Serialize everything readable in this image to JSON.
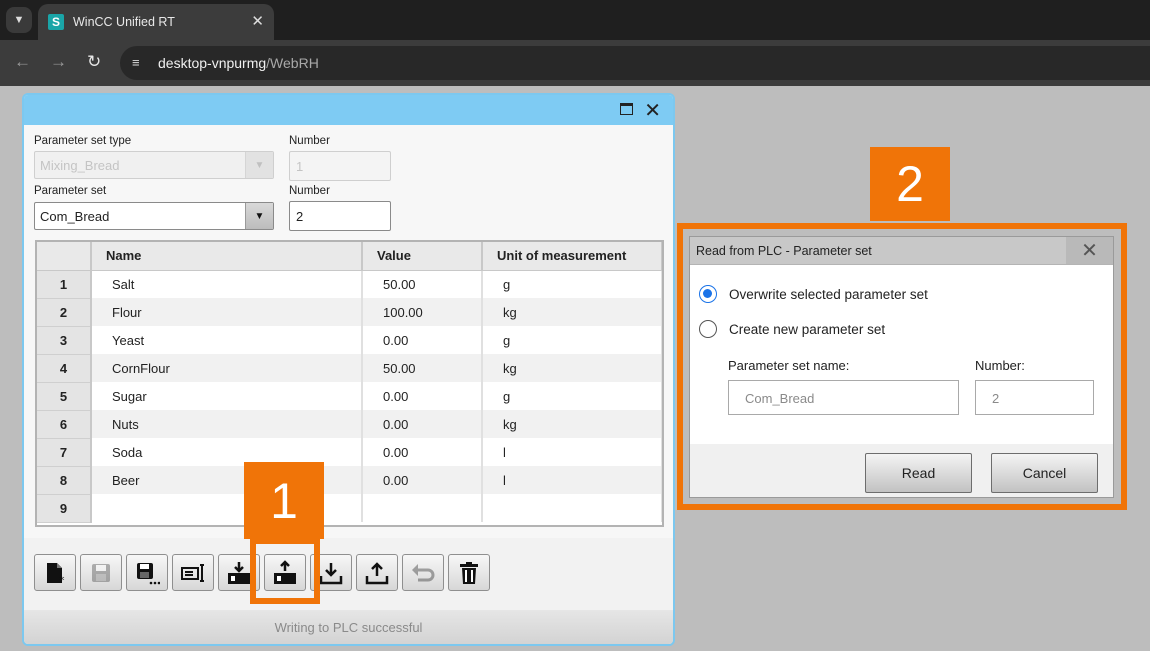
{
  "browser": {
    "tab_title": "WinCC Unified RT",
    "tab_icon_letter": "S",
    "url_host": "desktop-vnpurmg",
    "url_path": "/WebRH"
  },
  "recipe": {
    "set_type_label": "Parameter set type",
    "set_type_value": "Mixing_Bread",
    "number_label_1": "Number",
    "number_value_1": "1",
    "set_label": "Parameter set",
    "set_value": "Com_Bread",
    "number_label_2": "Number",
    "number_value_2": "2",
    "columns": [
      "Name",
      "Value",
      "Unit of measurement"
    ],
    "rows": [
      {
        "n": "1",
        "name": "Salt",
        "value": "50.00",
        "unit": "g"
      },
      {
        "n": "2",
        "name": "Flour",
        "value": "100.00",
        "unit": "kg"
      },
      {
        "n": "3",
        "name": "Yeast",
        "value": "0.00",
        "unit": "g"
      },
      {
        "n": "4",
        "name": "CornFlour",
        "value": "50.00",
        "unit": "kg"
      },
      {
        "n": "5",
        "name": "Sugar",
        "value": "0.00",
        "unit": "g"
      },
      {
        "n": "6",
        "name": "Nuts",
        "value": "0.00",
        "unit": "kg"
      },
      {
        "n": "7",
        "name": "Soda",
        "value": "0.00",
        "unit": "l"
      },
      {
        "n": "8",
        "name": "Beer",
        "value": "0.00",
        "unit": "l"
      },
      {
        "n": "9",
        "name": "",
        "value": "",
        "unit": ""
      }
    ],
    "toolbar_icons": [
      "new-icon",
      "save-icon",
      "save-as-icon",
      "rename-icon",
      "write-to-plc-icon",
      "read-from-plc-icon",
      "import-icon",
      "export-icon",
      "undo-icon",
      "delete-icon"
    ],
    "status": "Writing to PLC successful"
  },
  "annotations": {
    "badge1": "1",
    "badge2": "2",
    "color": "#f07408"
  },
  "dialog": {
    "title": "Read from PLC - Parameter set",
    "option_overwrite": "Overwrite selected parameter set",
    "option_create": "Create new parameter set",
    "name_label": "Parameter set name:",
    "name_value": "Com_Bread",
    "number_label": "Number:",
    "number_value": "2",
    "read_label": "Read",
    "cancel_label": "Cancel"
  }
}
